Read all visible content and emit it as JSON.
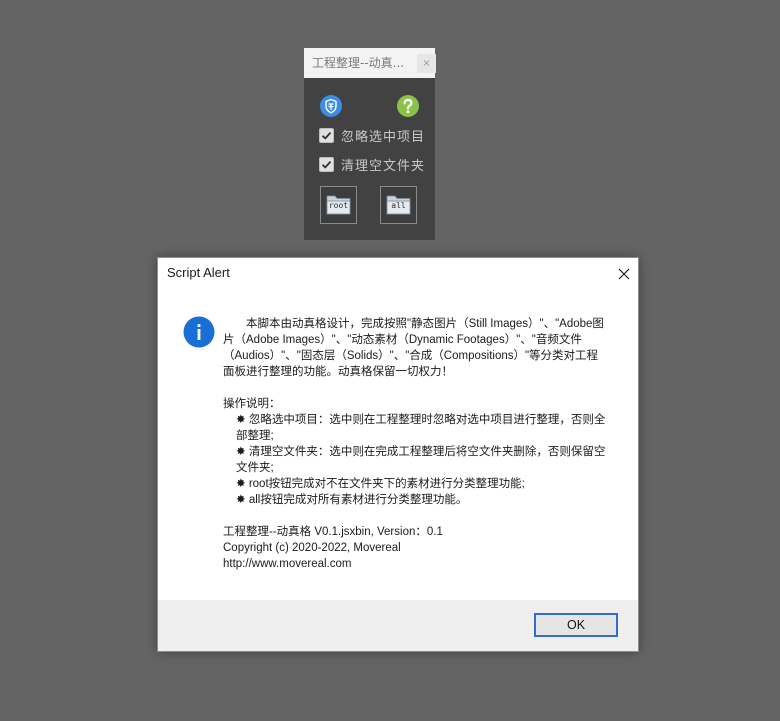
{
  "panel": {
    "title": "工程整理--动真...",
    "close_label": "×",
    "checkboxes": [
      {
        "label": "忽略选中项目",
        "checked": true
      },
      {
        "label": "清理空文件夹",
        "checked": true
      }
    ],
    "buttons": [
      {
        "label": "root"
      },
      {
        "label": "all"
      }
    ],
    "colors": {
      "shield_blue": "#3a8ee6",
      "help_green": "#8bc34a"
    }
  },
  "dialog": {
    "title": "Script Alert",
    "intro": "　　本脚本由动真格设计，完成按照\"静态图片（Still Images）\"、\"Adobe图片（Adobe Images）\"、\"动态素材（Dynamic Footages）\"、\"音频文件（Audios）\"、\"固态层（Solids）\"、\"合成（Compositions）\"等分类对工程面板进行整理的功能。动真格保留一切权力！",
    "instructions_header": "操作说明：",
    "instructions": [
      "✸ 忽略选中项目：选中则在工程整理时忽略对选中项目进行整理，否则全部整理;",
      "✸ 清理空文件夹：选中则在完成工程整理后将空文件夹删除，否则保留空文件夹;",
      "✸ root按钮完成对不在文件夹下的素材进行分类整理功能;",
      "✸ all按钮完成对所有素材进行分类整理功能。"
    ],
    "version": "工程整理--动真格 V0.1.jsxbin, Version：0.1",
    "copyright": "Copyright (c) 2020-2022, Movereal",
    "url": "http://www.movereal.com",
    "ok_label": "OK",
    "colors": {
      "info_blue": "#1a6fd6",
      "ok_border": "#2f6fcc"
    }
  }
}
